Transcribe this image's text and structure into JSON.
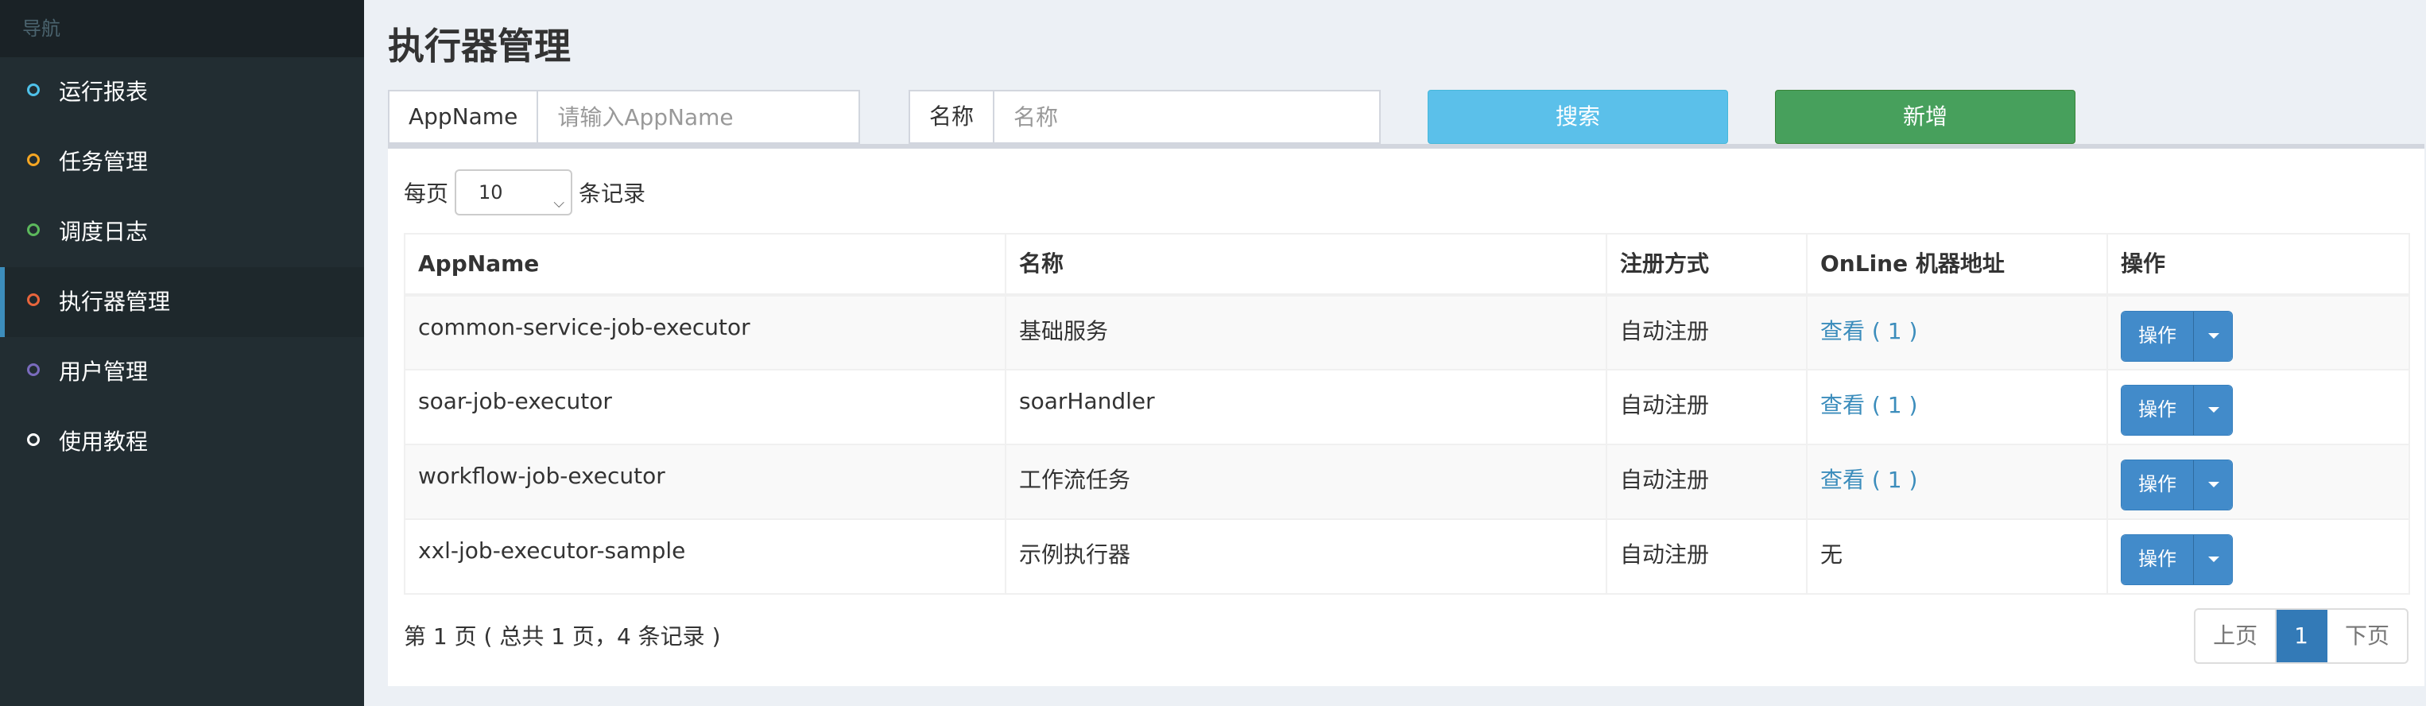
{
  "sidebar": {
    "header": "导航",
    "items": [
      {
        "label": "运行报表",
        "color": "#4fc1e9"
      },
      {
        "label": "任务管理",
        "color": "#f5a623"
      },
      {
        "label": "调度日志",
        "color": "#5cb85c"
      },
      {
        "label": "执行器管理",
        "color": "#e8653c",
        "active": true
      },
      {
        "label": "用户管理",
        "color": "#7a6bbd"
      },
      {
        "label": "使用教程",
        "color": "#ffffff"
      }
    ]
  },
  "page": {
    "title": "执行器管理"
  },
  "filters": {
    "appname": {
      "label": "AppName",
      "placeholder": "请输入AppName"
    },
    "name": {
      "label": "名称",
      "placeholder": "名称"
    },
    "search_label": "搜索",
    "add_label": "新增"
  },
  "length": {
    "prefix": "每页",
    "value": "10",
    "suffix": "条记录"
  },
  "table": {
    "headers": [
      "AppName",
      "名称",
      "注册方式",
      "OnLine 机器地址",
      "操作"
    ],
    "rows": [
      {
        "appname": "common-service-job-executor",
        "name": "基础服务",
        "reg": "自动注册",
        "online": "查看 ( 1 )",
        "op": "操作"
      },
      {
        "appname": "soar-job-executor",
        "name": "soarHandler",
        "reg": "自动注册",
        "online": "查看 ( 1 )",
        "op": "操作"
      },
      {
        "appname": "workflow-job-executor",
        "name": "工作流任务",
        "reg": "自动注册",
        "online": "查看 ( 1 )",
        "op": "操作"
      },
      {
        "appname": "xxl-job-executor-sample",
        "name": "示例执行器",
        "reg": "自动注册",
        "online": "无",
        "op": "操作"
      }
    ]
  },
  "footer": {
    "info": "第 1 页 ( 总共 1 页，4 条记录 )",
    "prev": "上页",
    "current": "1",
    "next": "下页"
  }
}
